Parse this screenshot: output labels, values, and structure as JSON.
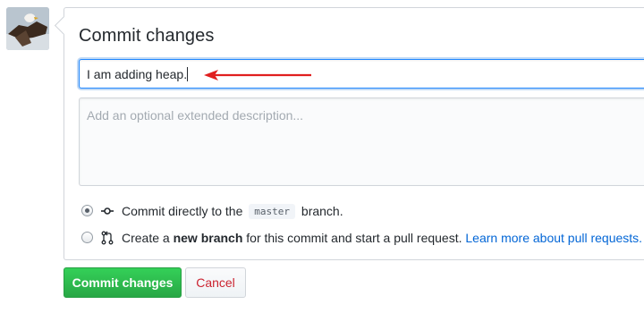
{
  "commit_form": {
    "title": "Commit changes",
    "summary_value": "I am adding heap.",
    "description_placeholder": "Add an optional extended description...",
    "option_direct": {
      "prefix": "Commit directly to the",
      "branch": "master",
      "suffix": "branch.",
      "selected": true
    },
    "option_new_branch": {
      "prefix": "Create a",
      "bold": "new branch",
      "suffix": "for this commit and start a pull request.",
      "link": "Learn more about pull requests.",
      "selected": false
    },
    "commit_button": "Commit changes",
    "cancel_button": "Cancel"
  },
  "icons": {
    "avatar": "eagle-photo",
    "commit": "git-commit-icon",
    "pull_request": "git-pull-request-icon",
    "annotation_arrow": "red-arrow"
  },
  "colors": {
    "primary_green": "#28a745",
    "link_blue": "#0366d6",
    "cancel_red": "#cb2431",
    "focus_blue": "#2188ff",
    "annotation_red": "#e01f1f"
  }
}
